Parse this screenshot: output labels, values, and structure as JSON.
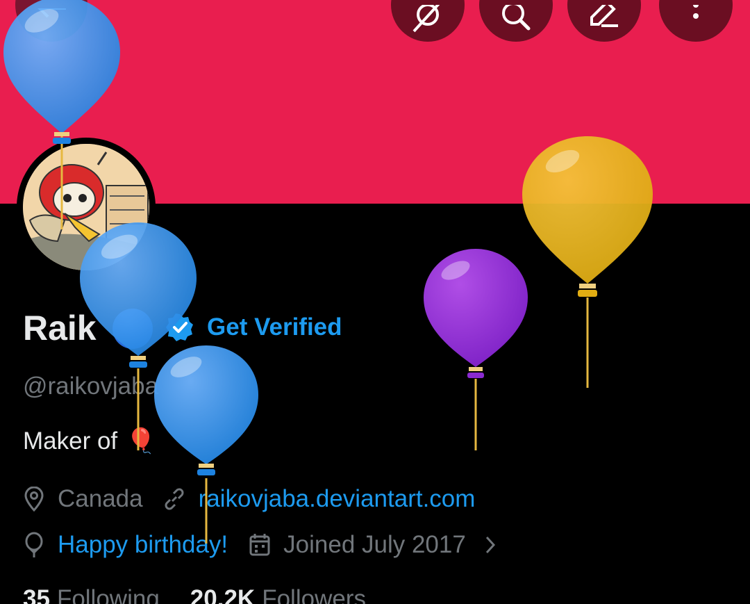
{
  "header": {
    "buttons": [
      {
        "icon": "grok-icon"
      },
      {
        "icon": "search-icon"
      },
      {
        "icon": "edit-icon"
      },
      {
        "icon": "more-icon"
      }
    ],
    "banner_color": "#e91e4f"
  },
  "profile": {
    "display_name": "Raik",
    "get_verified_label": "Get Verified",
    "handle": "@raikovjaba",
    "bio_text": "Maker of",
    "bio_emoji": "🎈",
    "location": "Canada",
    "website": "raikovjaba.deviantart.com",
    "birthday": "Happy birthday!",
    "joined": "Joined July 2017",
    "following_count": "35",
    "following_label": "Following",
    "followers_count": "20.2K",
    "followers_label": "Followers"
  },
  "colors": {
    "accent": "#1d9bf0",
    "text_primary": "#e7e9ea",
    "text_secondary": "#71767b",
    "background": "#000000"
  }
}
